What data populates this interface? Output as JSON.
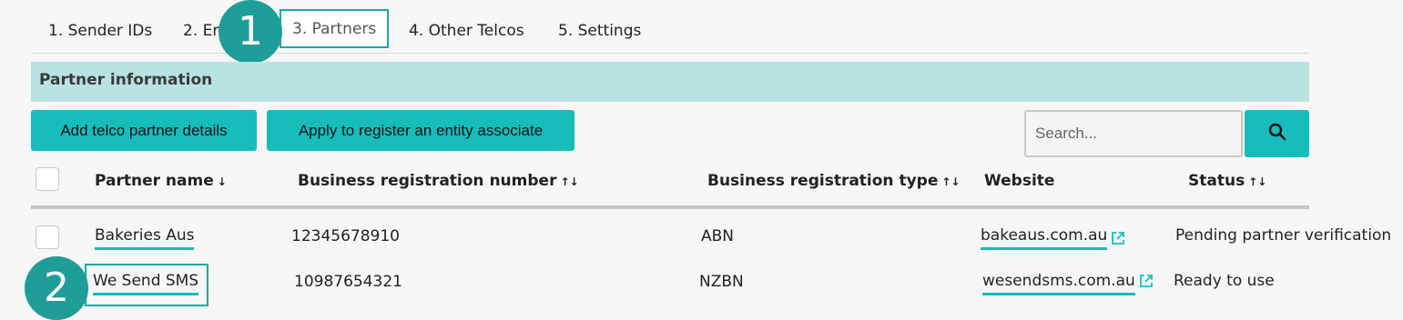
{
  "tabs": [
    {
      "label": "1. Sender IDs"
    },
    {
      "label": "2. En"
    },
    {
      "label": "3. Partners"
    },
    {
      "label": "4. Other Telcos"
    },
    {
      "label": "5. Settings"
    }
  ],
  "markers": {
    "first": "1",
    "second": "2"
  },
  "section": {
    "title": "Partner information"
  },
  "buttons": {
    "add_partner": "Add telco partner details",
    "apply_entity": "Apply to register an entity associate"
  },
  "search": {
    "placeholder": "Search..."
  },
  "table": {
    "columns": {
      "partner_name": "Partner name",
      "brn": "Business registration number",
      "brt": "Business registration type",
      "website": "Website",
      "status": "Status"
    },
    "sort_icons": {
      "down": "↓",
      "both": "↑↓"
    },
    "rows": [
      {
        "partner_name": "Bakeries Aus",
        "brn": "12345678910",
        "brt": "ABN",
        "website": "bakeaus.com.au",
        "status": "Pending partner verification"
      },
      {
        "partner_name": "We Send SMS",
        "brn": "10987654321",
        "brt": "NZBN",
        "website": "wesendsms.com.au",
        "status": "Ready to use"
      }
    ]
  },
  "icons": {
    "search": "search-icon",
    "external": "external-link-icon"
  },
  "colors": {
    "accent": "#17bdbb",
    "header_bg": "#b8e3e1",
    "marker": "#1f9d99"
  }
}
